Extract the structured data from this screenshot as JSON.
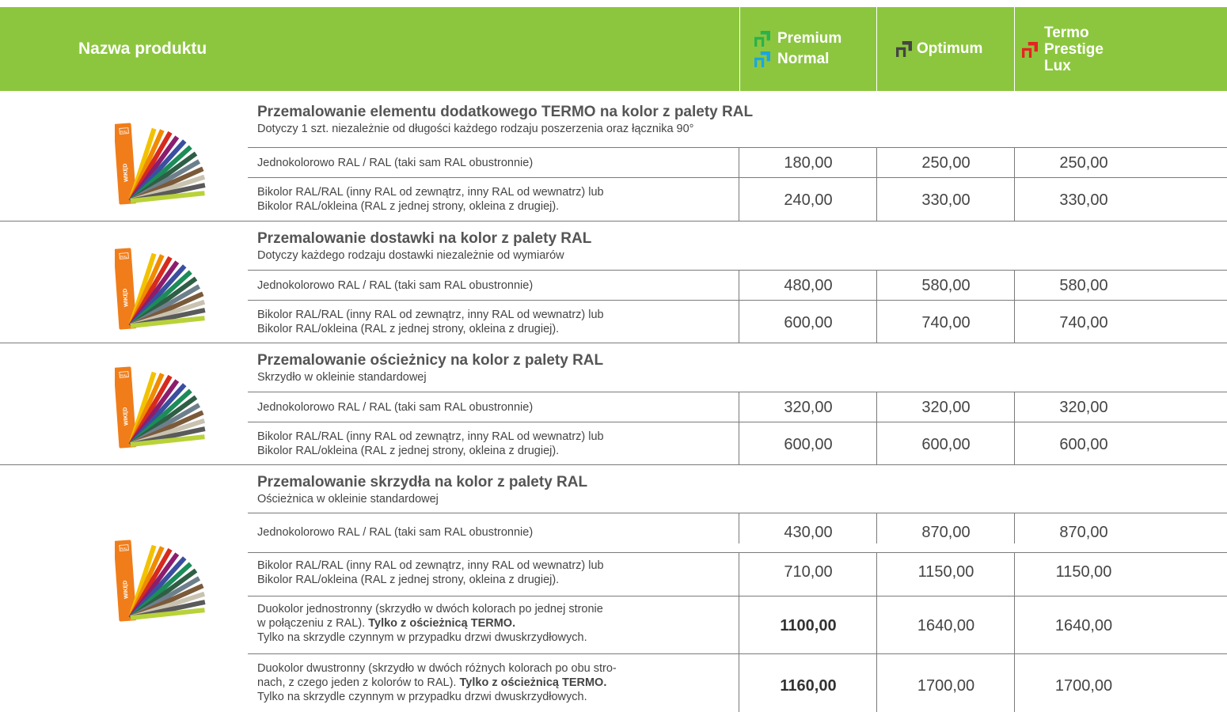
{
  "header": {
    "product_name": "Nazwa produktu",
    "col_premium": "Premium",
    "col_normal": "Normal",
    "col_optimum": "Optimum",
    "col_termo": "Termo",
    "col_prestige": "Prestige",
    "col_lux": "Lux",
    "colors": {
      "background": "#8cc63f",
      "premium_icon": "#8cc63f",
      "normal_icon": "#1aa7e0",
      "optimum_icon": "#444444",
      "termo_icon": "#e52421"
    }
  },
  "fan": {
    "ral_label": "RAL",
    "brand": "WIKĘD"
  },
  "sections": [
    {
      "title": "Przemalowanie elementu dodatkowego TERMO na kolor z palety RAL",
      "subtitle": "Dotyczy 1 szt. niezależnie od długości każdego rodzaju poszerzenia oraz łącznika 90°",
      "rows": [
        {
          "desc": "Jednokolorowo RAL / RAL (taki sam RAL obustronnie)",
          "p1": "180,00",
          "p2": "250,00",
          "p3": "250,00"
        },
        {
          "desc_l1": "Bikolor RAL/RAL (inny RAL od zewnątrz, inny RAL od wewnatrz) lub",
          "desc_l2": "Bikolor RAL/okleina (RAL z jednej strony, okleina z drugiej).",
          "p1": "240,00",
          "p2": "330,00",
          "p3": "330,00"
        }
      ]
    },
    {
      "title": "Przemalowanie dostawki na kolor z palety RAL",
      "subtitle": "Dotyczy każdego rodzaju dostawki niezależnie od wymiarów",
      "rows": [
        {
          "desc": "Jednokolorowo RAL / RAL (taki sam RAL obustronnie)",
          "p1": "480,00",
          "p2": "580,00",
          "p3": "580,00"
        },
        {
          "desc_l1": "Bikolor RAL/RAL (inny RAL od zewnątrz, inny RAL od wewnatrz) lub",
          "desc_l2": "Bikolor RAL/okleina (RAL z jednej strony, okleina z drugiej).",
          "p1": "600,00",
          "p2": "740,00",
          "p3": "740,00"
        }
      ]
    },
    {
      "title": "Przemalowanie ościeżnicy na kolor z palety RAL",
      "subtitle": "Skrzydło w okleinie standardowej",
      "rows": [
        {
          "desc": "Jednokolorowo RAL / RAL (taki sam RAL obustronnie)",
          "p1": "320,00",
          "p2": "320,00",
          "p3": "320,00"
        },
        {
          "desc_l1": "Bikolor RAL/RAL (inny RAL od zewnątrz, inny RAL od wewnatrz) lub",
          "desc_l2": "Bikolor RAL/okleina (RAL z jednej strony, okleina z drugiej).",
          "p1": "600,00",
          "p2": "600,00",
          "p3": "600,00"
        }
      ]
    },
    {
      "title": "Przemalowanie skrzydła na kolor z palety RAL",
      "subtitle": "Ościeżnica w okleinie standardowej",
      "rows": [
        {
          "desc": "Jednokolorowo RAL / RAL (taki sam RAL obustronnie)",
          "p1": "430,00",
          "p2": "870,00",
          "p3": "870,00"
        },
        {
          "desc_l1": "Bikolor RAL/RAL (inny RAL od zewnątrz, inny RAL od wewnatrz) lub",
          "desc_l2": "Bikolor RAL/okleina (RAL z jednej strony, okleina z drugiej).",
          "p1": "710,00",
          "p2": "1150,00",
          "p3": "1150,00"
        },
        {
          "desc_l1": "Duokolor jednostronny (skrzydło w dwóch kolorach po jednej stronie",
          "desc_l2a": "w połączeniu z RAL).",
          "desc_l2b": "Tylko z ościeżnicą TERMO.",
          "desc_l3": "Tylko na skrzydle czynnym w przypadku drzwi dwuskrzydłowych.",
          "p1": "1100,00",
          "p2": "1640,00",
          "p3": "1640,00"
        },
        {
          "desc_l1": "Duokolor dwustronny (skrzydło w dwóch różnych kolorach po obu stro-",
          "desc_l2a": "nach, z czego jeden z kolorów to RAL).",
          "desc_l2b": "Tylko z ościeżnicą TERMO.",
          "desc_l3": "Tylko na skrzydle czynnym w przypadku drzwi dwuskrzydłowych.",
          "p1": "1160,00",
          "p2": "1700,00",
          "p3": "1700,00"
        }
      ]
    }
  ]
}
